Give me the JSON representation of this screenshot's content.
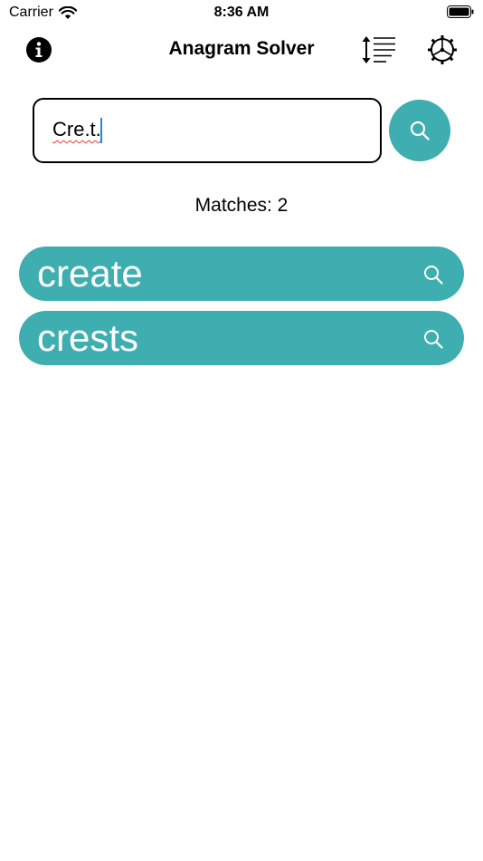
{
  "status_bar": {
    "carrier": "Carrier",
    "time": "8:36 AM"
  },
  "nav": {
    "title": "Anagram Solver",
    "icons": [
      "info-icon",
      "sort-lines-icon",
      "settings-gear-icon"
    ]
  },
  "search": {
    "value": "Cre.t.",
    "button_icon": "search-icon"
  },
  "matches_label": "Matches: 2",
  "results": [
    {
      "word": "create",
      "icon": "search-icon"
    },
    {
      "word": "crests",
      "icon": "search-icon"
    }
  ],
  "colors": {
    "accent": "#3eaeb0",
    "caret": "#1e88e5",
    "spellcheck": "#e53935"
  }
}
